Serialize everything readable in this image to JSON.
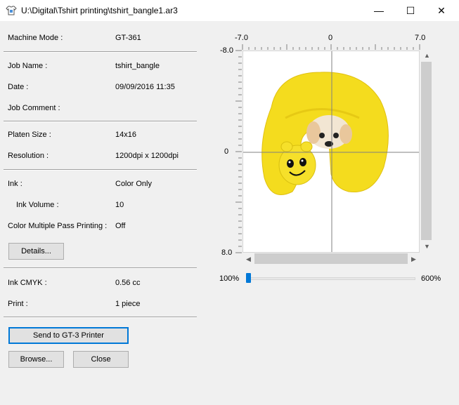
{
  "window": {
    "title": "U:\\Digital\\Tshirt printing\\tshirt_bangle1.ar3",
    "minimize_glyph": "—",
    "maximize_glyph": "☐",
    "close_glyph": "✕"
  },
  "info": {
    "machine_mode": {
      "label": "Machine Mode :",
      "value": "GT-361"
    },
    "job_name": {
      "label": "Job Name :",
      "value": "tshirt_bangle"
    },
    "date": {
      "label": "Date :",
      "value": "09/09/2016 11:35"
    },
    "job_comment": {
      "label": "Job Comment :",
      "value": ""
    },
    "platen_size": {
      "label": "Platen Size :",
      "value": "14x16"
    },
    "resolution": {
      "label": "Resolution :",
      "value": "1200dpi x 1200dpi"
    },
    "ink": {
      "label": "Ink :",
      "value": "Color Only"
    },
    "ink_volume": {
      "label": "Ink Volume :",
      "value": "10"
    },
    "color_multiple_pass": {
      "label": "Color Multiple Pass Printing :",
      "value": "Off"
    },
    "ink_cmyk": {
      "label": "Ink CMYK :",
      "value": "0.56 cc"
    },
    "print": {
      "label": "Print :",
      "value": "1 piece"
    }
  },
  "buttons": {
    "details": "Details...",
    "send": "Send to GT-3 Printer",
    "browse": "Browse...",
    "close": "Close"
  },
  "preview": {
    "x_min_label": "-7.0",
    "x_zero_label": "0",
    "x_max_label": "7.0",
    "y_min_label": "-8.0",
    "y_zero_label": "0",
    "y_max_label": "8.0",
    "image_icon": "yellow-pillow-dog-image"
  },
  "zoom": {
    "min_label": "100%",
    "max_label": "600%",
    "value_fraction": 0
  },
  "colors": {
    "accent": "#0078d7",
    "pillow_yellow": "#f4dc1e"
  }
}
